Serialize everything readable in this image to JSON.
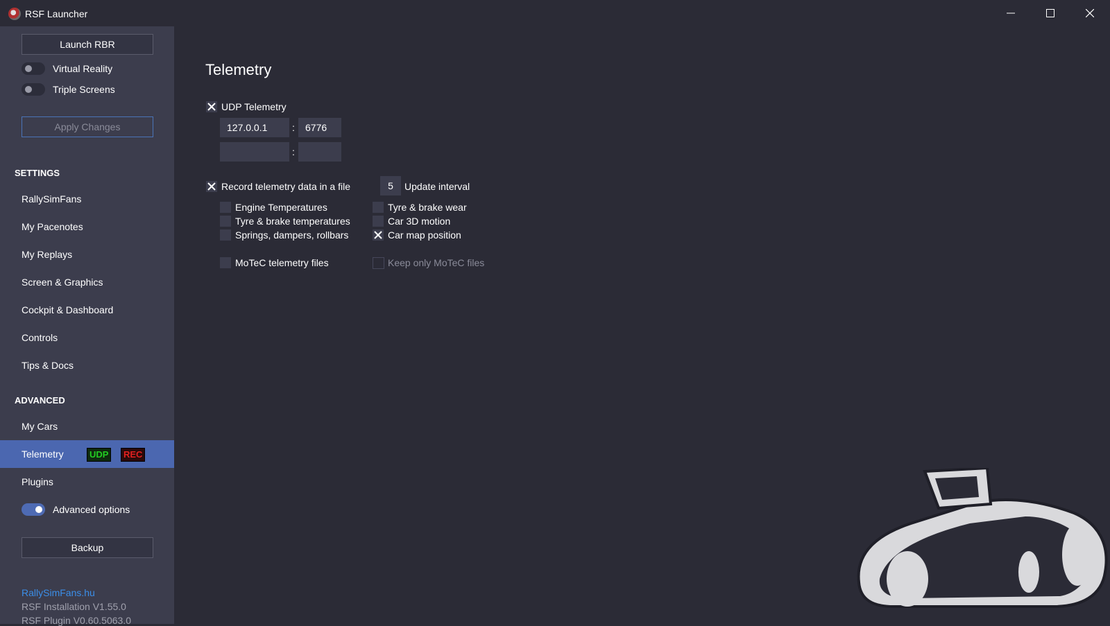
{
  "window": {
    "title": "RSF Launcher"
  },
  "sidebar": {
    "launch_button": "Launch RBR",
    "toggles": [
      {
        "label": "Virtual Reality",
        "on": false
      },
      {
        "label": "Triple Screens",
        "on": false
      }
    ],
    "apply_button": "Apply Changes",
    "settings_header": "SETTINGS",
    "settings_items": [
      "RallySimFans",
      "My Pacenotes",
      "My Replays",
      "Screen & Graphics",
      "Cockpit & Dashboard",
      "Controls",
      "Tips & Docs"
    ],
    "advanced_header": "ADVANCED",
    "advanced_items": [
      "My Cars",
      "Telemetry",
      "Plugins"
    ],
    "telemetry_badges": {
      "udp": "UDP",
      "rec": "REC"
    },
    "advanced_options": {
      "label": "Advanced options",
      "on": true
    },
    "backup_button": "Backup",
    "footer": {
      "link": "RallySimFans.hu",
      "installation": "RSF Installation V1.55.0",
      "plugin": "RSF Plugin V0.60.5063.0"
    }
  },
  "main": {
    "title": "Telemetry",
    "udp": {
      "label": "UDP Telemetry",
      "checked": true,
      "host1": "127.0.0.1",
      "port1": "6776",
      "host2": "",
      "port2": "",
      "separator": ":"
    },
    "record": {
      "label": "Record telemetry data in a file",
      "checked": true,
      "interval_value": "5",
      "interval_label": "Update interval"
    },
    "options_left": [
      {
        "label": "Engine Temperatures",
        "checked": false
      },
      {
        "label": "Tyre & brake temperatures",
        "checked": false
      },
      {
        "label": "Springs, dampers, rollbars",
        "checked": false
      }
    ],
    "options_right": [
      {
        "label": "Tyre & brake wear",
        "checked": false
      },
      {
        "label": "Car 3D motion",
        "checked": false
      },
      {
        "label": "Car map position",
        "checked": true
      }
    ],
    "motec": {
      "label": "MoTeC telemetry files",
      "checked": false
    },
    "keep_motec": {
      "label": "Keep only MoTeC files",
      "checked": false,
      "disabled": true
    }
  },
  "colors": {
    "background": "#2b2b36",
    "sidebar": "#3c3d4d",
    "accent": "#4b67b0",
    "link": "#3b8ee8",
    "udp_badge": "#22cc22",
    "rec_badge": "#e02020"
  }
}
